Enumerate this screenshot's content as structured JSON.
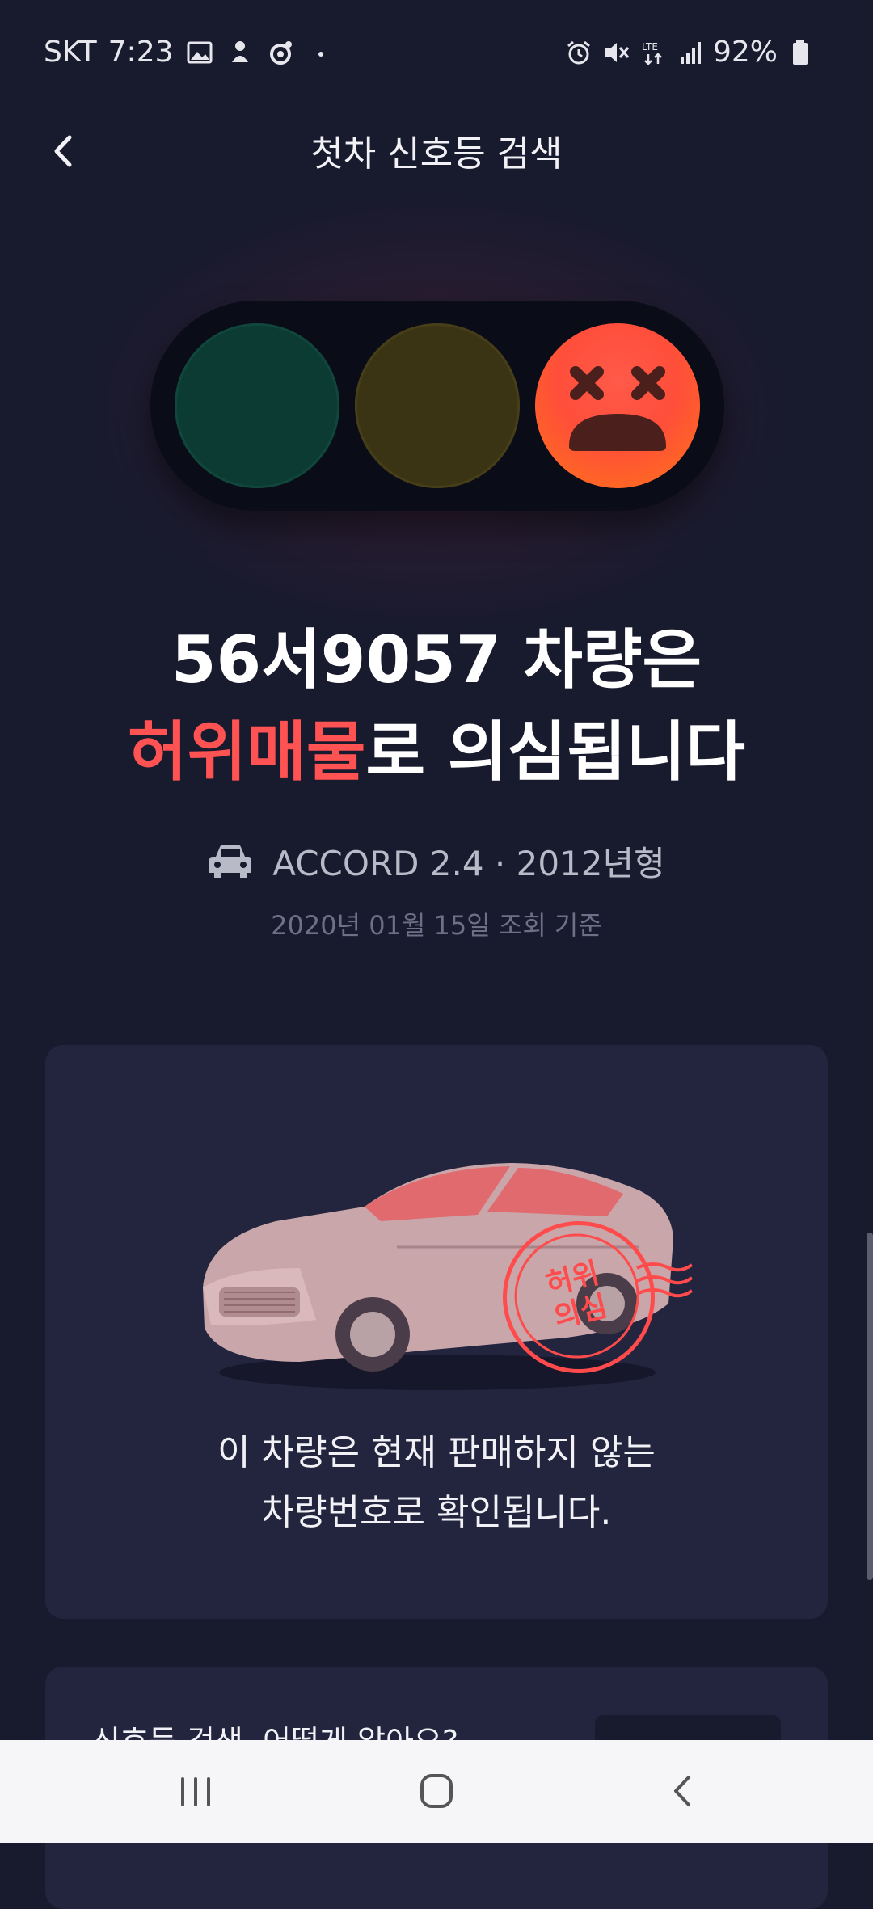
{
  "status_bar": {
    "carrier": "SKT",
    "time": "7:23",
    "battery": "92%",
    "icons_left": [
      "image-icon",
      "notification-icon",
      "record-icon",
      "dot-icon"
    ],
    "icons_right": [
      "alarm-icon",
      "mute-icon",
      "lte-icon",
      "signal-icon",
      "battery-icon"
    ]
  },
  "header": {
    "title": "첫차 신호등 검색",
    "back_icon": "chevron-left-icon"
  },
  "traffic_light": {
    "active": "red",
    "lamps": [
      "green",
      "yellow",
      "red"
    ],
    "face_icon": "dizzy-face-icon",
    "colors": {
      "green": "#0b3b33",
      "yellow": "#3a3414",
      "red": "#ff5a4a"
    }
  },
  "result": {
    "line1": "56서9057 차량은",
    "highlight": "허위매물",
    "line2_rest": "로 의심됩니다",
    "highlight_color": "#ff5252"
  },
  "vehicle": {
    "icon": "car-icon",
    "model_text": "ACCORD 2.4 · 2012년형",
    "date_text": "2020년 01월 15일 조회 기준"
  },
  "card": {
    "image": "sedan-car-illustration",
    "stamp_line1": "허위",
    "stamp_line2": "의심",
    "message_line1": "이 차량은 현재 판매하지 않는",
    "message_line2": "차량번호로 확인됩니다."
  },
  "card2": {
    "title": "신호등 검색, 어떻게 알아요?"
  },
  "nav_bar": {
    "recents": "recents-icon",
    "home": "home-icon",
    "back": "back-icon"
  }
}
